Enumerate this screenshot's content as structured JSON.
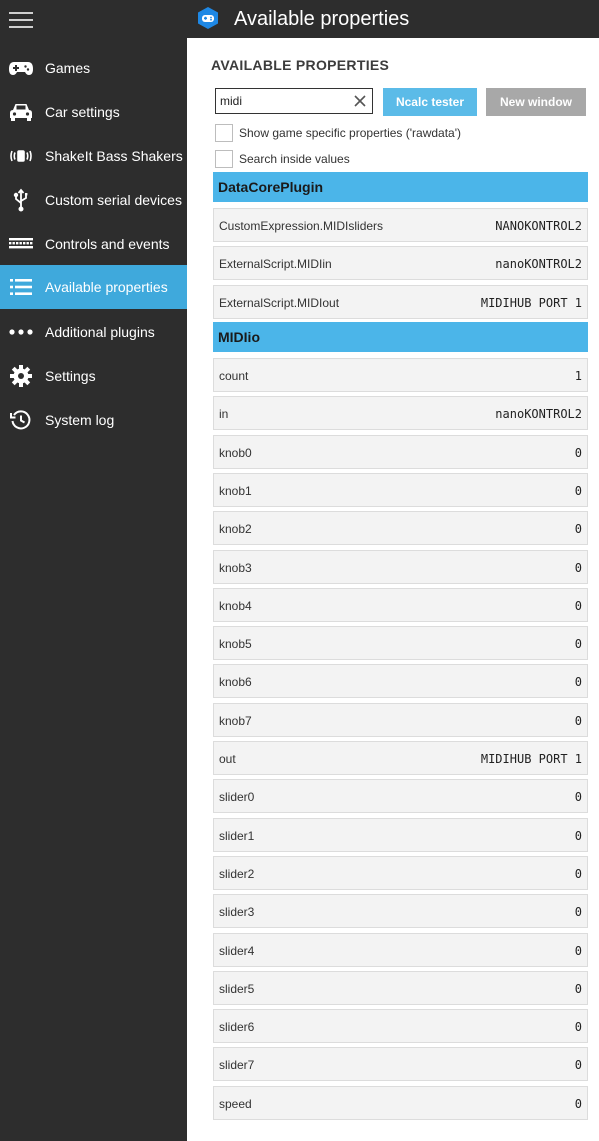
{
  "window": {
    "title": "Available properties"
  },
  "sidebar": {
    "items": [
      {
        "label": "Games",
        "icon": "gamepad-icon",
        "active": false
      },
      {
        "label": "Car settings",
        "icon": "car-icon",
        "active": false
      },
      {
        "label": "ShakeIt Bass Shakers",
        "icon": "vibration-icon",
        "active": false
      },
      {
        "label": "Custom serial devices",
        "icon": "usb-icon",
        "active": false
      },
      {
        "label": "Controls and events",
        "icon": "keyboard-icon",
        "active": false
      },
      {
        "label": "Available properties",
        "icon": "list-icon",
        "active": true
      },
      {
        "label": "Additional plugins",
        "icon": "more-icon",
        "active": false
      },
      {
        "label": "Settings",
        "icon": "gear-icon",
        "active": false
      },
      {
        "label": "System log",
        "icon": "history-icon",
        "active": false
      }
    ]
  },
  "main": {
    "heading": "AVAILABLE PROPERTIES",
    "search": {
      "value": "midi"
    },
    "buttons": {
      "ncalc": "Ncalc tester",
      "new_window": "New window"
    },
    "checkboxes": [
      {
        "label": "Show game specific properties ('rawdata')",
        "checked": false
      },
      {
        "label": "Search inside values",
        "checked": false
      }
    ],
    "groups": [
      {
        "name": "DataCorePlugin",
        "rows": [
          {
            "name": "CustomExpression.MIDIsliders",
            "value": "NANOKONTROL2"
          },
          {
            "name": "ExternalScript.MIDIin",
            "value": "nanoKONTROL2"
          },
          {
            "name": "ExternalScript.MIDIout",
            "value": "MIDIHUB PORT 1"
          }
        ]
      },
      {
        "name": "MIDIio",
        "rows": [
          {
            "name": "count",
            "value": "1"
          },
          {
            "name": "in",
            "value": "nanoKONTROL2"
          },
          {
            "name": "knob0",
            "value": "0"
          },
          {
            "name": "knob1",
            "value": "0"
          },
          {
            "name": "knob2",
            "value": "0"
          },
          {
            "name": "knob3",
            "value": "0"
          },
          {
            "name": "knob4",
            "value": "0"
          },
          {
            "name": "knob5",
            "value": "0"
          },
          {
            "name": "knob6",
            "value": "0"
          },
          {
            "name": "knob7",
            "value": "0"
          },
          {
            "name": "out",
            "value": "MIDIHUB PORT 1"
          },
          {
            "name": "slider0",
            "value": "0"
          },
          {
            "name": "slider1",
            "value": "0"
          },
          {
            "name": "slider2",
            "value": "0"
          },
          {
            "name": "slider3",
            "value": "0"
          },
          {
            "name": "slider4",
            "value": "0"
          },
          {
            "name": "slider5",
            "value": "0"
          },
          {
            "name": "slider6",
            "value": "0"
          },
          {
            "name": "slider7",
            "value": "0"
          },
          {
            "name": "speed",
            "value": "0"
          }
        ]
      }
    ]
  },
  "colors": {
    "accent": "#3fa9dc",
    "group_header": "#4bb5e9",
    "sidebar_bg": "#2d2d2d"
  }
}
